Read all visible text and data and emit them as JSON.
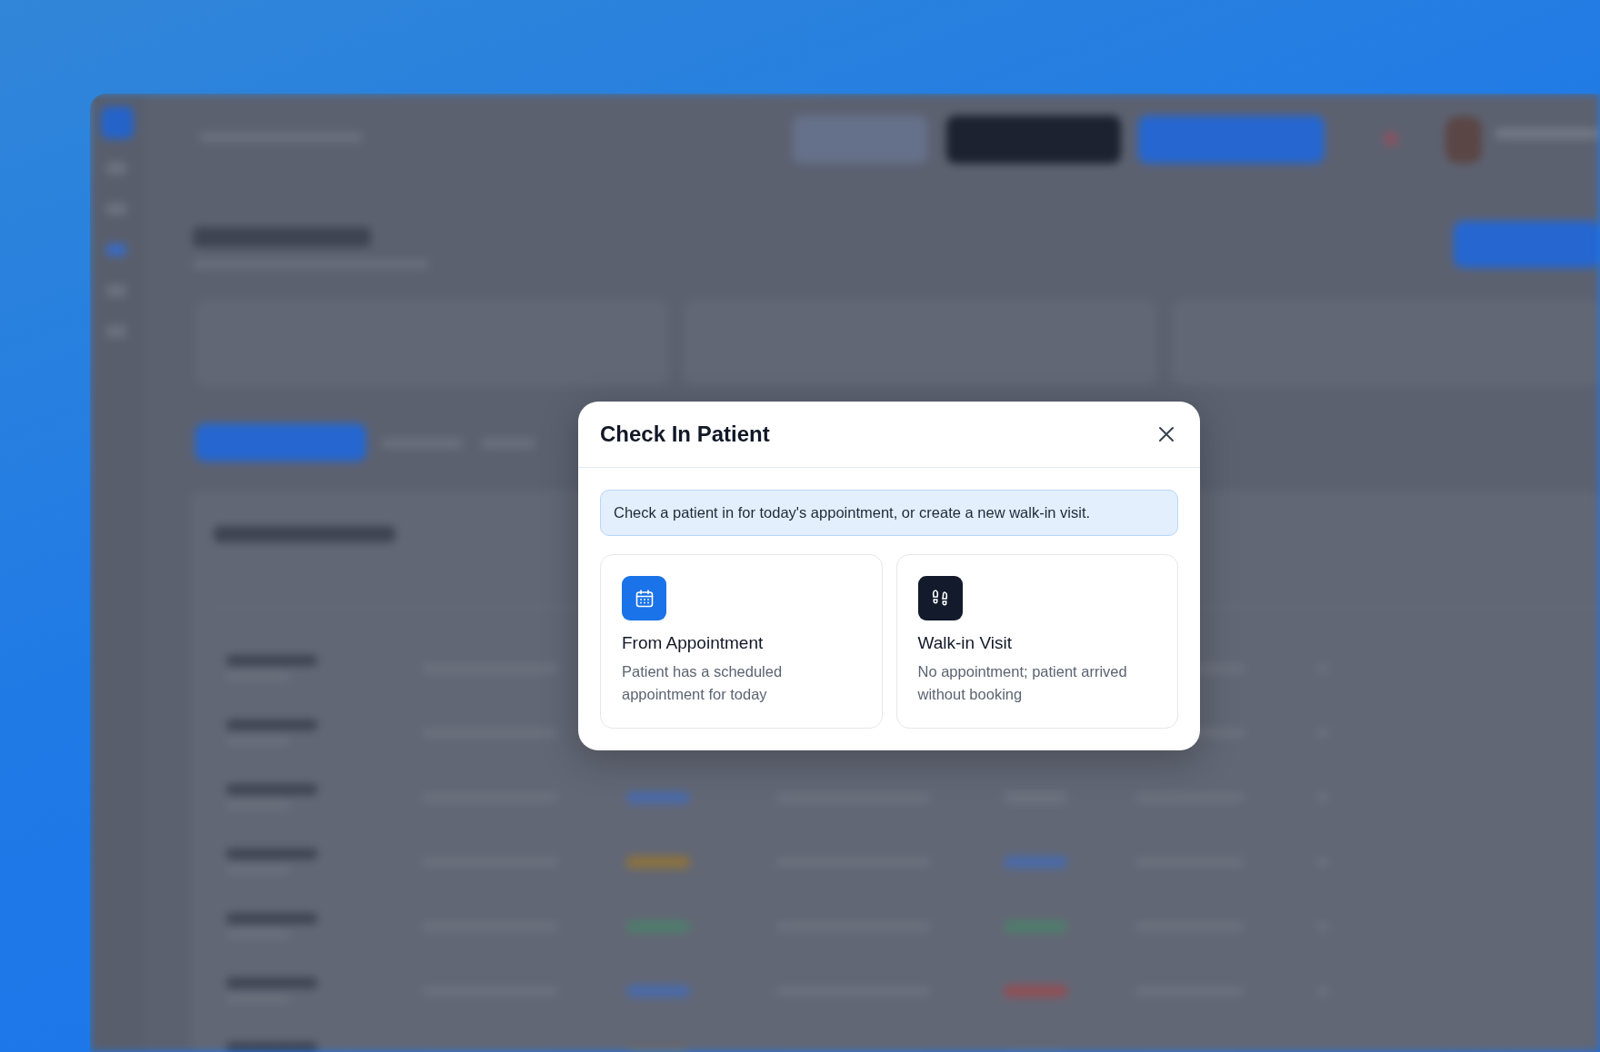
{
  "dialog": {
    "title": "Check In Patient",
    "info": "Check a patient in for today's appointment, or create a new walk-in visit.",
    "options": [
      {
        "kind": "appointment",
        "title": "From Appointment",
        "description": "Patient has a scheduled appointment for today"
      },
      {
        "kind": "walkin",
        "title": "Walk-in Visit",
        "description": "No appointment; patient arrived without booking"
      }
    ]
  }
}
